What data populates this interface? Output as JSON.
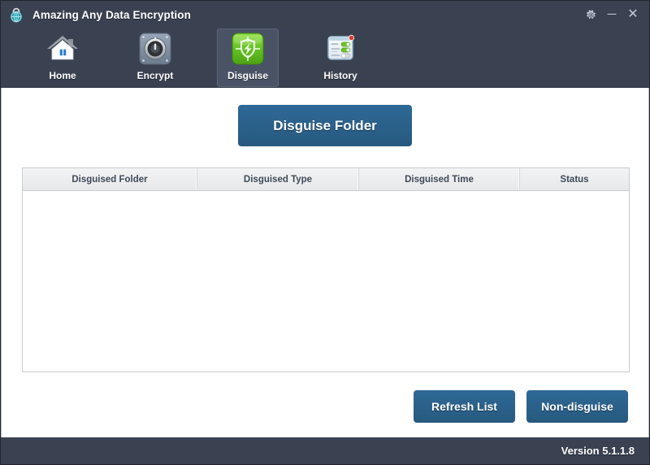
{
  "window": {
    "title": "Amazing Any Data Encryption",
    "app_icon": "globe-lock-icon",
    "controls": {
      "settings_label": "⚙",
      "minimize_label": "─",
      "close_label": "✕"
    }
  },
  "nav": {
    "items": [
      {
        "id": "home",
        "label": "Home",
        "icon": "house-icon",
        "active": false
      },
      {
        "id": "encrypt",
        "label": "Encrypt",
        "icon": "safe-dial-icon",
        "active": false
      },
      {
        "id": "disguise",
        "label": "Disguise",
        "icon": "green-shield-bolt-icon",
        "active": true
      },
      {
        "id": "history",
        "label": "History",
        "icon": "history-list-icon",
        "active": false
      }
    ]
  },
  "main": {
    "primary_button": "Disguise Folder",
    "table": {
      "columns": [
        "Disguised Folder",
        "Disguised Type",
        "Disguised Time",
        "Status"
      ],
      "rows": []
    },
    "actions": [
      {
        "id": "refresh",
        "label": "Refresh List"
      },
      {
        "id": "non-disguise",
        "label": "Non-disguise"
      }
    ]
  },
  "footer": {
    "version": "Version 5.1.1.8"
  },
  "colors": {
    "chrome": "#3a4252",
    "accent_button": "#2b6390",
    "content_bg": "#ffffff",
    "header_row": "#eceded",
    "active_tab": "#4a5366",
    "disguise_green": "#6dc82a"
  }
}
